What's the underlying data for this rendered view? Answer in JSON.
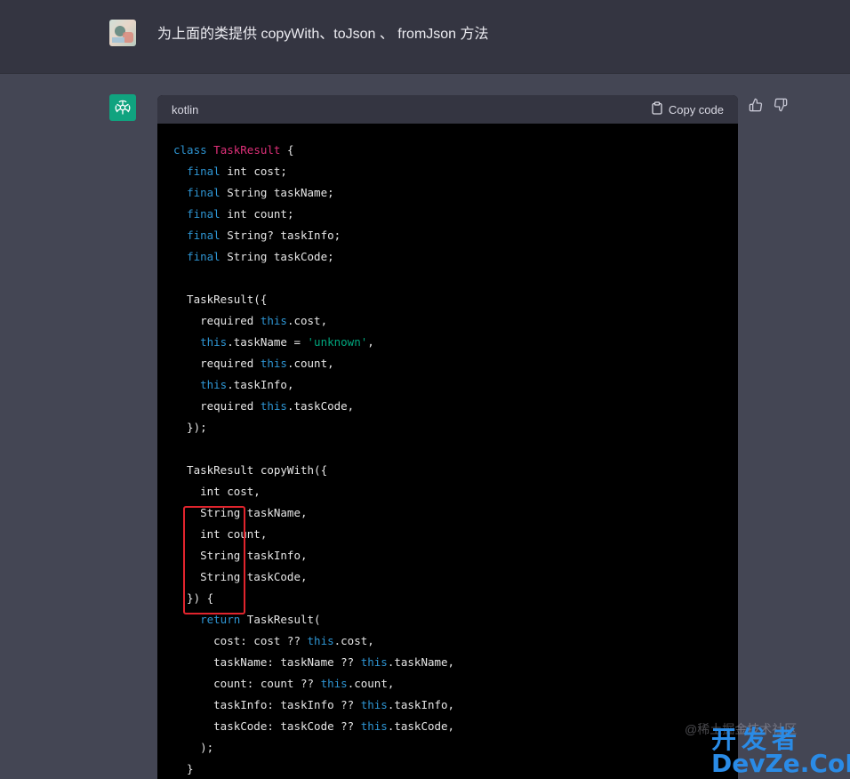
{
  "user_message": {
    "text": "为上面的类提供 copyWith、toJson 、 fromJson 方法"
  },
  "code_block": {
    "language": "kotlin",
    "copy_label": "Copy code"
  },
  "code_lines": [
    [
      [
        "kw",
        "class"
      ],
      [
        "t",
        " "
      ],
      [
        "cls",
        "TaskResult"
      ],
      [
        "t",
        " {"
      ]
    ],
    [
      [
        "t",
        "  "
      ],
      [
        "kw",
        "final"
      ],
      [
        "t",
        " int cost;"
      ]
    ],
    [
      [
        "t",
        "  "
      ],
      [
        "kw",
        "final"
      ],
      [
        "t",
        " String taskName;"
      ]
    ],
    [
      [
        "t",
        "  "
      ],
      [
        "kw",
        "final"
      ],
      [
        "t",
        " int count;"
      ]
    ],
    [
      [
        "t",
        "  "
      ],
      [
        "kw",
        "final"
      ],
      [
        "t",
        " String? taskInfo;"
      ]
    ],
    [
      [
        "t",
        "  "
      ],
      [
        "kw",
        "final"
      ],
      [
        "t",
        " String taskCode;"
      ]
    ],
    [
      [
        "t",
        ""
      ]
    ],
    [
      [
        "t",
        "  TaskResult({"
      ]
    ],
    [
      [
        "t",
        "    required "
      ],
      [
        "kw",
        "this"
      ],
      [
        "t",
        ".cost,"
      ]
    ],
    [
      [
        "t",
        "    "
      ],
      [
        "kw",
        "this"
      ],
      [
        "t",
        ".taskName = "
      ],
      [
        "str",
        "'unknown'"
      ],
      [
        "t",
        ","
      ]
    ],
    [
      [
        "t",
        "    required "
      ],
      [
        "kw",
        "this"
      ],
      [
        "t",
        ".count,"
      ]
    ],
    [
      [
        "t",
        "    "
      ],
      [
        "kw",
        "this"
      ],
      [
        "t",
        ".taskInfo,"
      ]
    ],
    [
      [
        "t",
        "    required "
      ],
      [
        "kw",
        "this"
      ],
      [
        "t",
        ".taskCode,"
      ]
    ],
    [
      [
        "t",
        "  });"
      ]
    ],
    [
      [
        "t",
        ""
      ]
    ],
    [
      [
        "t",
        "  TaskResult copyWith({"
      ]
    ],
    [
      [
        "t",
        "    int cost,"
      ]
    ],
    [
      [
        "t",
        "    String taskName,"
      ]
    ],
    [
      [
        "t",
        "    int count,"
      ]
    ],
    [
      [
        "t",
        "    String taskInfo,"
      ]
    ],
    [
      [
        "t",
        "    String taskCode,"
      ]
    ],
    [
      [
        "t",
        "  }) {"
      ]
    ],
    [
      [
        "t",
        "    "
      ],
      [
        "kw",
        "return"
      ],
      [
        "t",
        " TaskResult("
      ]
    ],
    [
      [
        "t",
        "      cost: cost ?? "
      ],
      [
        "kw",
        "this"
      ],
      [
        "t",
        ".cost,"
      ]
    ],
    [
      [
        "t",
        "      taskName: taskName ?? "
      ],
      [
        "kw",
        "this"
      ],
      [
        "t",
        ".taskName,"
      ]
    ],
    [
      [
        "t",
        "      count: count ?? "
      ],
      [
        "kw",
        "this"
      ],
      [
        "t",
        ".count,"
      ]
    ],
    [
      [
        "t",
        "      taskInfo: taskInfo ?? "
      ],
      [
        "kw",
        "this"
      ],
      [
        "t",
        ".taskInfo,"
      ]
    ],
    [
      [
        "t",
        "      taskCode: taskCode ?? "
      ],
      [
        "kw",
        "this"
      ],
      [
        "t",
        ".taskCode,"
      ]
    ],
    [
      [
        "t",
        "    );"
      ]
    ],
    [
      [
        "t",
        "  }"
      ]
    ]
  ],
  "watermark": {
    "handle": "@稀土掘金技术社区",
    "logo_top": "开发者",
    "logo_bottom": "DevZe.CoM"
  },
  "icons": {
    "user_avatar": "user-avatar-image",
    "bot_avatar": "openai-logo-icon",
    "copy": "clipboard-icon",
    "thumbs_up": "thumbs-up-icon",
    "thumbs_down": "thumbs-down-icon"
  },
  "colors": {
    "keyword": "#2e95d3",
    "class_name": "#df3079",
    "string": "#00a67d",
    "highlight": "#e0242d",
    "bot_accent": "#10a37f"
  }
}
